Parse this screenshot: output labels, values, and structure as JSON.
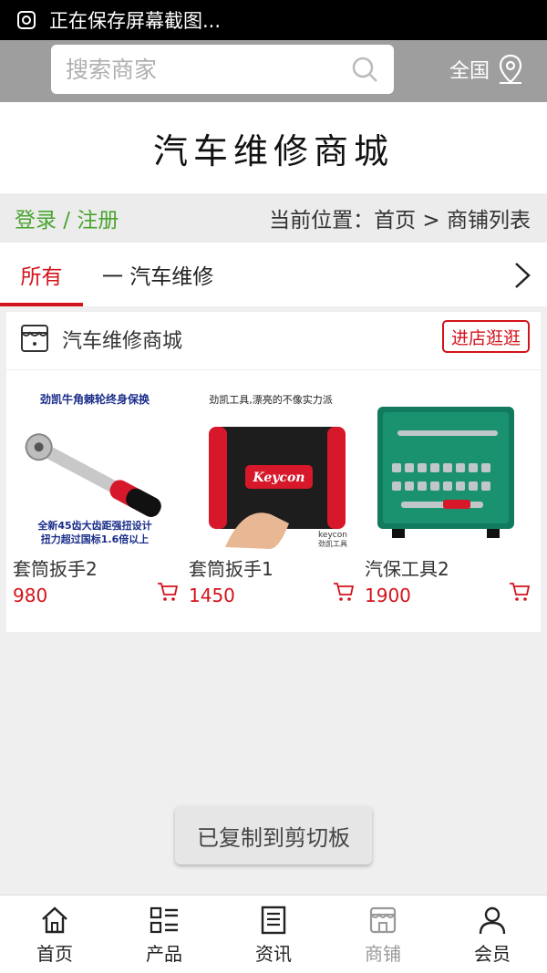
{
  "status_bar": {
    "text": "正在保存屏幕截图..."
  },
  "search": {
    "placeholder": "搜索商家",
    "region_label": "全国"
  },
  "site_title": "汽车维修商城",
  "breadcrumb": {
    "login": "登录 / 注册",
    "location": "当前位置：首页 > 商铺列表"
  },
  "tabs": {
    "all": "所有",
    "category": "一 汽车维修"
  },
  "shop": {
    "name": "汽车维修商城",
    "enter_label": "进店逛逛",
    "products": [
      {
        "name": "套筒扳手2",
        "price": "980",
        "image_caption": "劲凯牛角棘轮终身保换",
        "image_caption2": "全新45齿大齿距强扭设计",
        "image_caption3": "扭力超过国标1.6倍以上"
      },
      {
        "name": "套筒扳手1",
        "price": "1450",
        "image_caption": "劲凯工具,漂亮的不像实力派",
        "brand": "Keycon",
        "brand2": "keycon",
        "brand3": "劲凯工具"
      },
      {
        "name": "汽保工具2",
        "price": "1900"
      }
    ]
  },
  "toast": "已复制到剪切板",
  "bottom_nav": [
    {
      "label": "首页",
      "icon": "home-icon"
    },
    {
      "label": "产品",
      "icon": "grid-list-icon"
    },
    {
      "label": "资讯",
      "icon": "news-icon"
    },
    {
      "label": "商铺",
      "icon": "store-icon",
      "active": true
    },
    {
      "label": "会员",
      "icon": "user-icon"
    }
  ],
  "colors": {
    "accent": "#d3131b",
    "login_green": "#49a52f",
    "search_bar_bg": "#9e9e9e"
  }
}
